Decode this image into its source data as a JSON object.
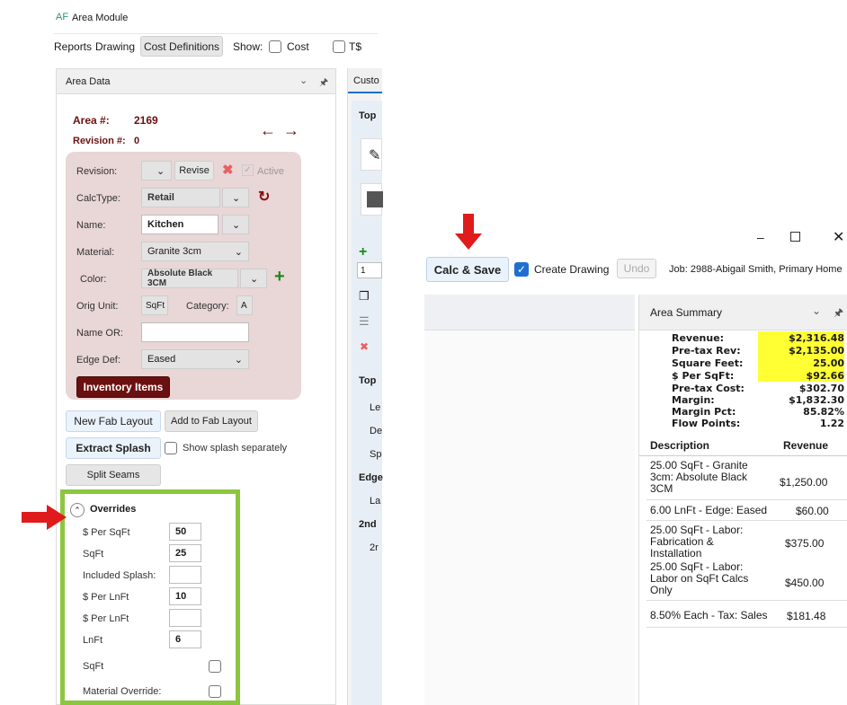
{
  "app": {
    "logo": "AF",
    "title": "Area Module"
  },
  "toolbar": {
    "reports": "Reports",
    "drawing": "Drawing",
    "cost_definitions": "Cost Definitions",
    "show": "Show:",
    "cost": "Cost",
    "ts": "T$"
  },
  "area_panel": {
    "title": "Area Data",
    "area_label": "Area #:",
    "area_value": "2169",
    "revision_label": "Revision #:",
    "revision_value": "0",
    "form": {
      "revision_label": "Revision:",
      "revise_button": "Revise",
      "active_label": "Active",
      "calctype_label": "CalcType:",
      "calctype_value": "Retail",
      "name_label": "Name:",
      "name_value": "Kitchen",
      "material_label": "Material:",
      "material_value": "Granite 3cm",
      "color_label": "Color:",
      "color_value": "Absolute Black 3CM",
      "orig_unit_label": "Orig Unit:",
      "orig_unit_value": "SqFt",
      "category_label": "Category:",
      "category_value": "A",
      "name_or_label": "Name OR:",
      "name_or_value": "",
      "edge_def_label": "Edge Def:",
      "edge_def_value": "Eased",
      "inventory_button": "Inventory Items"
    },
    "new_fab_layout": "New Fab Layout",
    "add_fab_layout": "Add to Fab Layout",
    "extract_splash": "Extract Splash",
    "show_splash": "Show splash separately",
    "split_seams": "Split Seams",
    "overrides": {
      "title": "Overrides",
      "rows": [
        {
          "label": "$ Per SqFt",
          "value": "50"
        },
        {
          "label": "SqFt",
          "value": "25"
        },
        {
          "label": "Included Splash:",
          "value": ""
        },
        {
          "label": "$ Per LnFt",
          "value": "10"
        },
        {
          "label": "$ Per LnFt",
          "value": ""
        },
        {
          "label": "LnFt",
          "value": "6"
        }
      ],
      "sqft_check": "SqFt",
      "material_override": "Material Override:"
    }
  },
  "middle_panel": {
    "tab": "Custo",
    "top1": "Top",
    "r1": "Le",
    "r2": "De",
    "r3": "Sp",
    "edge": "Edge",
    "r4": "La",
    "second": "2nd",
    "r5": "2r",
    "spin": "1"
  },
  "right": {
    "calc_save": "Calc & Save",
    "create_drawing": "Create Drawing",
    "undo": "Undo",
    "job": "Job: 2988-Abigail Smith, Primary Home",
    "summary_title": "Area Summary",
    "summary": [
      {
        "label": "Revenue:",
        "value": "$2,316.48",
        "hl": true
      },
      {
        "label": "Pre-tax Rev:",
        "value": "$2,135.00",
        "hl": true
      },
      {
        "label": "Square Feet:",
        "value": "25.00",
        "hl": true
      },
      {
        "label": "$ Per SqFt:",
        "value": "$92.66",
        "hl": true
      },
      {
        "label": "Pre-tax Cost:",
        "value": "$302.70",
        "hl": false
      },
      {
        "label": "Margin:",
        "value": "$1,832.30",
        "hl": false
      },
      {
        "label": "Margin Pct:",
        "value": "85.82%",
        "hl": false
      },
      {
        "label": "Flow Points:",
        "value": "1.22",
        "hl": false
      }
    ],
    "col_desc": "Description",
    "col_rev": "Revenue",
    "lines": [
      {
        "desc": "25.00 SqFt - Granite 3cm: Absolute Black 3CM",
        "rev": "$1,250.00"
      },
      {
        "desc": "6.00 LnFt - Edge: Eased",
        "rev": "$60.00"
      },
      {
        "desc": "25.00 SqFt - Labor: Fabrication & Installation",
        "rev": "$375.00"
      },
      {
        "desc": "25.00 SqFt - Labor: Labor on SqFt Calcs Only",
        "rev": "$450.00"
      },
      {
        "desc": "8.50% Each - Tax: Sales",
        "rev": "$181.48"
      }
    ]
  },
  "colors": {
    "maroon": "#6b1010",
    "pink_bg": "#e9d6d6",
    "green_border": "#8cc63f",
    "red_arrow": "#e01b1b",
    "highlight": "#ffff33",
    "check_blue": "#1f6fd1"
  }
}
